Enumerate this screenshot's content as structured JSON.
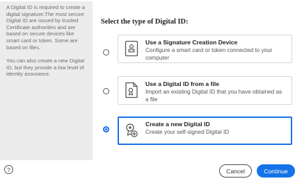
{
  "sidebar": {
    "paragraph_1": "A Digital ID is required to create a digital signature.The most secure Digital ID are issued by trusted Certificate authorities and are based on secure devices like smart card or token. Some are based on files.",
    "paragraph_2": "You can also create a new Digital ID, but they provide a low level of identity assurance."
  },
  "main": {
    "heading": "Select the type of Digital ID:",
    "options": [
      {
        "title": "Use a Signature Creation Device",
        "description": "Configure a smart card or token connected to your computer",
        "selected": false,
        "icon": "smart-card-icon"
      },
      {
        "title": "Use a Digital ID from a file",
        "description": "Import an existing Digital ID that you have obtained as a file",
        "selected": false,
        "icon": "certificate-file-icon"
      },
      {
        "title": "Create a new Digital ID",
        "description": "Create your self-signed Digital ID",
        "selected": true,
        "icon": "new-digital-id-icon"
      }
    ]
  },
  "footer": {
    "help_glyph": "?",
    "cancel_label": "Cancel",
    "continue_label": "Continue"
  },
  "colors": {
    "accent": "#1473e6",
    "sidebar_bg": "#ececec"
  }
}
